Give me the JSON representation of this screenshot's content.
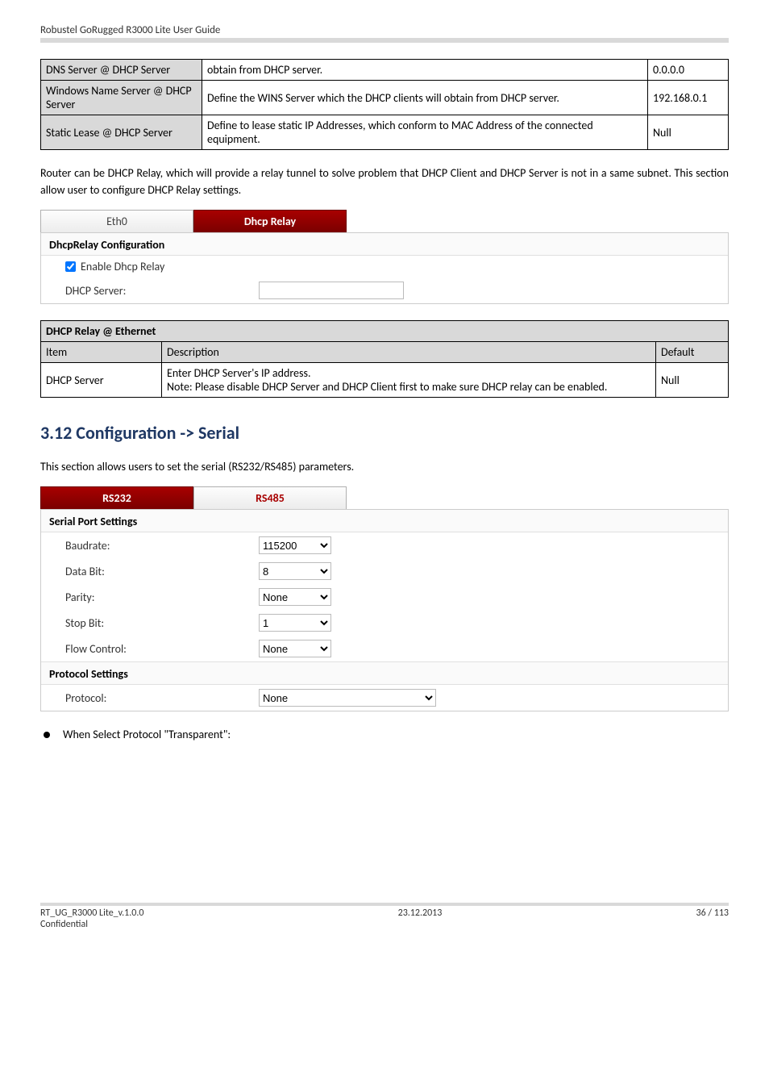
{
  "header": {
    "text": "Robustel GoRugged R3000 Lite User Guide"
  },
  "table1": {
    "r1c1": "DNS Server @ DHCP Server",
    "r1c2": "obtain from DHCP server.",
    "r1c3": "0.0.0.0",
    "r2c1": "Windows Name Server @ DHCP Server",
    "r2c2": "Define the WINS Server which the DHCP clients will obtain from DHCP server.",
    "r2c3": "192.168.0.1",
    "r3c1": "Static Lease @ DHCP Server",
    "r3c2": "Define to lease static IP Addresses, which conform to MAC Address of the connected equipment.",
    "r3c3": "Null"
  },
  "para1": "Router can be DHCP Relay, which will provide a relay tunnel to solve problem that DHCP Client and DHCP Server is not in a same subnet. This section allow user to configure DHCP Relay settings.",
  "tabs1": {
    "tab1": "Eth0",
    "tab2": "Dhcp Relay"
  },
  "panel1": {
    "title": "DhcpRelay Configuration",
    "row1": "Enable Dhcp Relay",
    "row2": "DHCP Server:"
  },
  "table2": {
    "title": "DHCP Relay @ Ethernet",
    "h1": "Item",
    "h2": "Description",
    "h3": "Default",
    "r1c1": "DHCP Server",
    "r1c2": "Enter DHCP Server's IP address.\nNote: Please disable DHCP Server and DHCP Client first to make sure DHCP relay can be enabled.",
    "r1c3": "Null"
  },
  "section": {
    "heading": "3.12  Configuration -> Serial"
  },
  "para2": "This section allows users to set the serial (RS232/RS485) parameters.",
  "tabs2": {
    "tab1": "RS232",
    "tab2": "RS485"
  },
  "panel2": {
    "title1": "Serial Port Settings",
    "baudrate_label": "Baudrate:",
    "baudrate_val": "115200",
    "databit_label": "Data Bit:",
    "databit_val": "8",
    "parity_label": "Parity:",
    "parity_val": "None",
    "stopbit_label": "Stop Bit:",
    "stopbit_val": "1",
    "flow_label": "Flow Control:",
    "flow_val": "None",
    "title2": "Protocol Settings",
    "protocol_label": "Protocol:",
    "protocol_val": "None"
  },
  "bullet": "When Select Protocol \"Transparent\":",
  "footer": {
    "left1": "RT_UG_R3000 Lite_v.1.0.0",
    "left2": "Confidential",
    "center": "23.12.2013",
    "right": "36 / 113"
  }
}
